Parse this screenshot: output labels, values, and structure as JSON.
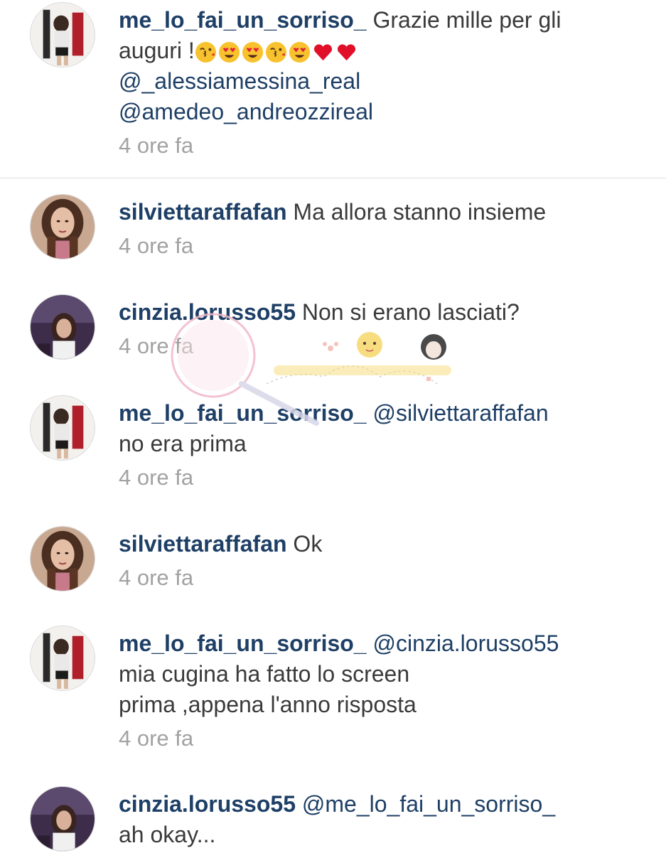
{
  "comments": [
    {
      "username": "me_lo_fai_un_sorriso_",
      "text_line1": "Grazie mille per gli",
      "text_line2": "auguri !",
      "emoji": [
        "kissing-face-icon",
        "heart-eyes-icon",
        "heart-eyes-icon",
        "kissing-face-icon",
        "heart-eyes-icon",
        "red-heart-icon",
        "red-heart-icon"
      ],
      "mention1": "@_alessiamessina_real",
      "mention2": "@amedeo_andreozzireal",
      "time": "4 ore fa"
    },
    {
      "username": "silviettaraffafan",
      "text": "Ma allora stanno insieme",
      "time": "4 ore fa"
    },
    {
      "username": "cinzia.lorusso55",
      "text": "Non si erano lasciati?",
      "time": "4 ore fa"
    },
    {
      "username": "me_lo_fai_un_sorriso_",
      "mention": "@silviettaraffafan",
      "text": "no era prima",
      "time": "4 ore fa"
    },
    {
      "username": "silviettaraffafan",
      "text": "Ok",
      "time": "4 ore fa"
    },
    {
      "username": "me_lo_fai_un_sorriso_",
      "mention": "@cinzia.lorusso55",
      "text_line1": "mia cugina ha fatto lo screen",
      "text_line2": "prima ,appena l'anno risposta",
      "time": "4 ore fa"
    },
    {
      "username": "cinzia.lorusso55",
      "mention": "@me_lo_fai_un_sorriso_",
      "text": "ah okay..."
    }
  ],
  "colors": {
    "username": "#1e3f66",
    "text": "#3a3a3a",
    "timestamp": "#a2a2a2",
    "divider": "#dedede"
  }
}
